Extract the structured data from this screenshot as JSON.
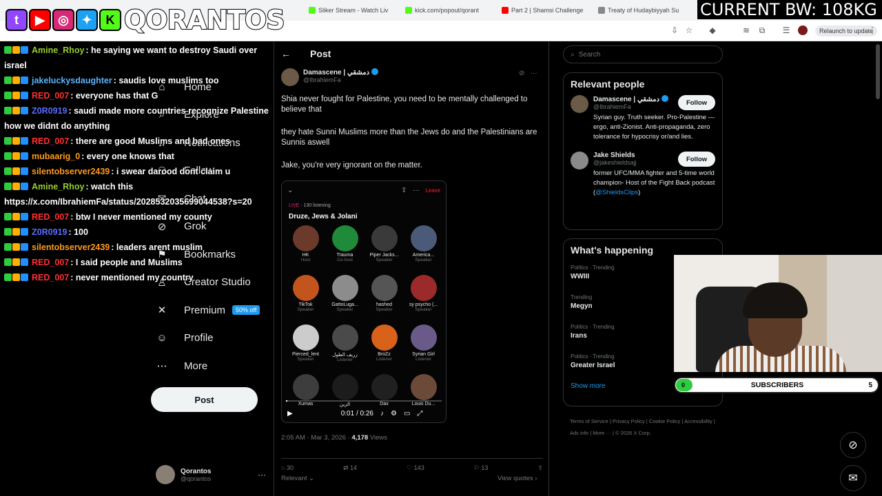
{
  "browser": {
    "tabs": [
      {
        "title": "Sliker Stream - Watch Liv",
        "color": "#53fc18"
      },
      {
        "title": "kick.com/popout/qorant",
        "color": "#53fc18"
      },
      {
        "title": "Part 2 | Shamsi Challenge",
        "color": "#ff0000"
      },
      {
        "title": "Treaty of Hudaybiyyah Su",
        "color": "#888888"
      }
    ],
    "relaunch_label": "Relaunch to update"
  },
  "overlay": {
    "streamer_name": "QORANTOS",
    "bw_text": "CURRENT BW: 108KG",
    "subs": {
      "current": "0",
      "label": "SUBSCRIBERS",
      "goal": "5",
      "progress": 0
    }
  },
  "chat": [
    {
      "user": "Amine_Rhoy",
      "color": "#9acd32",
      "msg": ": he saying we want to destroy Saudi over israel"
    },
    {
      "user": "jakeluckysdaughter",
      "color": "#5ab4ff",
      "msg": ": saudis love muslims too"
    },
    {
      "user": "RED_007",
      "color": "#ff3030",
      "msg": ": everyone has that G"
    },
    {
      "user": "Z0R0919",
      "color": "#5a6cff",
      "msg": ": saudi made more countries recognize Palestine how we didnt do anything"
    },
    {
      "user": "RED_007",
      "color": "#ff3030",
      "msg": ": there are good Muslims and bad ones"
    },
    {
      "user": "mubaarig_0",
      "color": "#ff9a1a",
      "msg": ": every one knows that"
    },
    {
      "user": "silentobserver2439",
      "color": "#ff9a1a",
      "msg": ": i swear darood dont claim u"
    },
    {
      "user": "Amine_Rhoy",
      "color": "#9acd32",
      "msg": ": watch this https://x.com/IbrahiemFa/status/2028532035699044538?s=20"
    },
    {
      "user": "RED_007",
      "color": "#ff3030",
      "msg": ": btw I never mentioned my county"
    },
    {
      "user": "Z0R0919",
      "color": "#5a6cff",
      "msg": ": 100"
    },
    {
      "user": "silentobserver2439",
      "color": "#ff9a1a",
      "msg": ": leaders arent muslim"
    },
    {
      "user": "RED_007",
      "color": "#ff3030",
      "msg": ": I said people and Muslims"
    },
    {
      "user": "RED_007",
      "color": "#ff3030",
      "msg": ": never mentioned my country"
    }
  ],
  "nav": {
    "items": [
      {
        "label": "Home",
        "icon": "home-icon",
        "glyph": "⌂"
      },
      {
        "label": "Explore",
        "icon": "search-icon",
        "glyph": "⌕"
      },
      {
        "label": "Notifications",
        "icon": "bell-icon",
        "glyph": "♫"
      },
      {
        "label": "Follow",
        "icon": "person-plus-icon",
        "glyph": "⚇"
      },
      {
        "label": "Chat",
        "icon": "chat-icon",
        "glyph": "✉"
      },
      {
        "label": "Grok",
        "icon": "grok-icon",
        "glyph": "⊘"
      },
      {
        "label": "Bookmarks",
        "icon": "bookmark-icon",
        "glyph": "⚑"
      },
      {
        "label": "Creator Studio",
        "icon": "creator-icon",
        "glyph": "♙"
      },
      {
        "label": "Premium",
        "icon": "x-logo-icon",
        "glyph": "✕",
        "badge": "50% off"
      },
      {
        "label": "Profile",
        "icon": "profile-icon",
        "glyph": "☺"
      },
      {
        "label": "More",
        "icon": "more-circle-icon",
        "glyph": "⋯"
      }
    ],
    "post_label": "Post",
    "me": {
      "name": "Qorantos",
      "handle": "@qorantos"
    }
  },
  "post": {
    "header": "Post",
    "author": {
      "name": "Damascene | دمشقي",
      "handle": "@IbrahiemFa"
    },
    "paragraphs": [
      "Shia never fought for Palestine, you need to be mentally challenged to believe that",
      "they hate Sunni Muslims more than the Jews do and the Palestinians are Sunnis aswell",
      "Jake, you're very ignorant on the matter."
    ],
    "video": {
      "leave": "Leave",
      "listening": "130 listening",
      "live": "LIVE",
      "title": "Druze, Jews & Jolani",
      "time": "0:01 / 0:26",
      "speakers": [
        {
          "name": "HK",
          "role": "Host",
          "color": "#6b3a2a"
        },
        {
          "name": "Trauma",
          "role": "Co-host",
          "color": "#1f8a3a"
        },
        {
          "name": "Piper Jacks...",
          "role": "Speaker",
          "color": "#3a3a3a"
        },
        {
          "name": "America...",
          "role": "Speaker",
          "color": "#4a5a78"
        },
        {
          "name": "TikTok",
          "role": "Speaker",
          "color": "#c2541e"
        },
        {
          "name": "GattoLuga...",
          "role": "Speaker",
          "color": "#8c8c8c"
        },
        {
          "name": "hashed",
          "role": "Speaker",
          "color": "#555555"
        },
        {
          "name": "sy psycho (...",
          "role": "Speaker",
          "color": "#9c2a2a"
        },
        {
          "name": "Pierced_lent",
          "role": "Speaker",
          "color": "#cccccc"
        },
        {
          "name": "زريف الطول",
          "role": "Listener",
          "color": "#4a4a4a"
        },
        {
          "name": "BroZz",
          "role": "Listener",
          "color": "#d8621a"
        },
        {
          "name": "Syrian Girl",
          "role": "Listener",
          "color": "#6a5a8a"
        },
        {
          "name": "Xumas",
          "role": "",
          "color": "#3d3d3d"
        },
        {
          "name": "الزين",
          "role": "",
          "color": "#1c1c1c"
        },
        {
          "name": "Dax",
          "role": "",
          "color": "#202020"
        },
        {
          "name": "Louis Du...",
          "role": "",
          "color": "#6b4a3a"
        }
      ]
    },
    "meta": {
      "time": "2:05 AM · Mar 3, 2026 · ",
      "views": "4,178",
      "views_label": " Views"
    },
    "actions": {
      "replies": "30",
      "reposts": "14",
      "likes": "143",
      "bookmarks": "13"
    },
    "relevant": "Relevant",
    "view_quotes": "View quotes"
  },
  "right": {
    "search_placeholder": "Search",
    "relevant_title": "Relevant people",
    "people": [
      {
        "name": "Damascene | دمشقي",
        "handle": "@IbrahiemFa",
        "bio": "Syrian guy. Truth seeker. Pro-Palestine —ergo, anti-Zionist. Anti-propaganda, zero tolerance for hypocrisy or/and lies.",
        "link": "",
        "follow": "Follow",
        "color": "#6b5a48"
      },
      {
        "name": "Jake Shields",
        "handle": "@jakeshieldsajj",
        "bio": "former UFC/MMA fighter and 5-time world champion- Host of the Fight Back podcast (",
        "link": "@ShieldsClips",
        "bio_end": ")",
        "follow": "Follow",
        "color": "#8a8a8a"
      }
    ],
    "happening_title": "What's happening",
    "trends": [
      {
        "category": "Politics · Trending",
        "topic": "WWIII"
      },
      {
        "category": "Trending",
        "topic": "Megyn"
      },
      {
        "category": "Politics · Trending",
        "topic": "Irans"
      },
      {
        "category": "Politics · Trending",
        "topic": "Greater Israel"
      }
    ],
    "show_more": "Show more",
    "footer": [
      "Terms of Service",
      "Privacy Policy",
      "Cookie Policy",
      "Accessibility",
      "Ads info",
      "More ···",
      "© 2026 X Corp."
    ]
  }
}
